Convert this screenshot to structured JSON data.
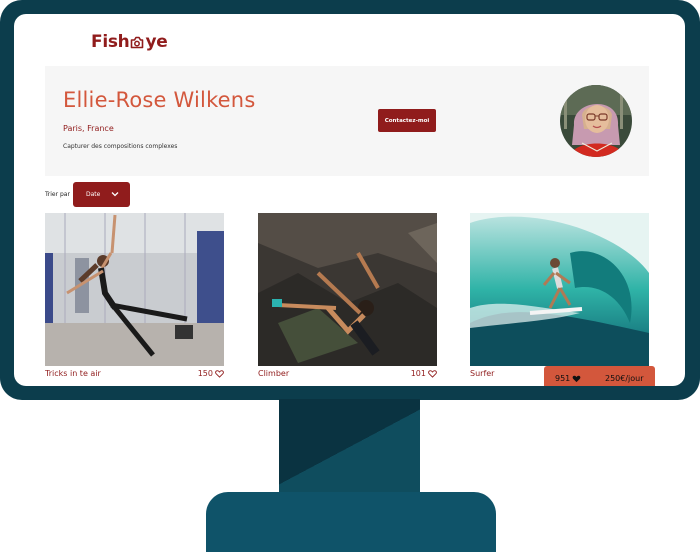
{
  "site": {
    "logo_text_left": "Fish",
    "logo_text_right": "ye"
  },
  "photographer": {
    "name": "Ellie-Rose Wilkens",
    "location": "Paris, France",
    "tagline": "Capturer des compositions complexes",
    "contact_label": "Contactez-moi"
  },
  "sort": {
    "label": "Trier par",
    "selected": "Date"
  },
  "media": [
    {
      "title": "Tricks in te air",
      "likes": "150"
    },
    {
      "title": "Climber",
      "likes": "101"
    },
    {
      "title": "Surfer",
      "likes": ""
    }
  ],
  "stats": {
    "total_likes": "951",
    "price": "250€/jour"
  },
  "colors": {
    "brand": "#901C1C",
    "accent": "#D3573C",
    "monitor": "#0C3D4C",
    "header_bg": "#F6F6F6"
  },
  "icons": [
    "camera-icon",
    "chevron-down-icon",
    "heart-outline-icon",
    "heart-filled-icon"
  ]
}
